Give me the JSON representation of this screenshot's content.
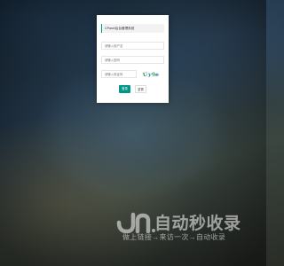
{
  "login": {
    "title": "CPanel后台管理系统",
    "username_placeholder": "请输入用户名",
    "password_placeholder": "请输入密码",
    "captcha_placeholder": "请输入验证码",
    "captcha_chars": [
      "U",
      "y",
      "9",
      "e"
    ],
    "login_button": "登录",
    "reset_button": "重置"
  },
  "colors": {
    "accent": "#009688",
    "captcha": [
      "#2a8a45",
      "#2f7da8",
      "#3aa050",
      "#1f6a9a"
    ]
  },
  "watermark": {
    "brand": "自动秒收录",
    "slogan": "做上链接→来访一次→自动收录"
  }
}
